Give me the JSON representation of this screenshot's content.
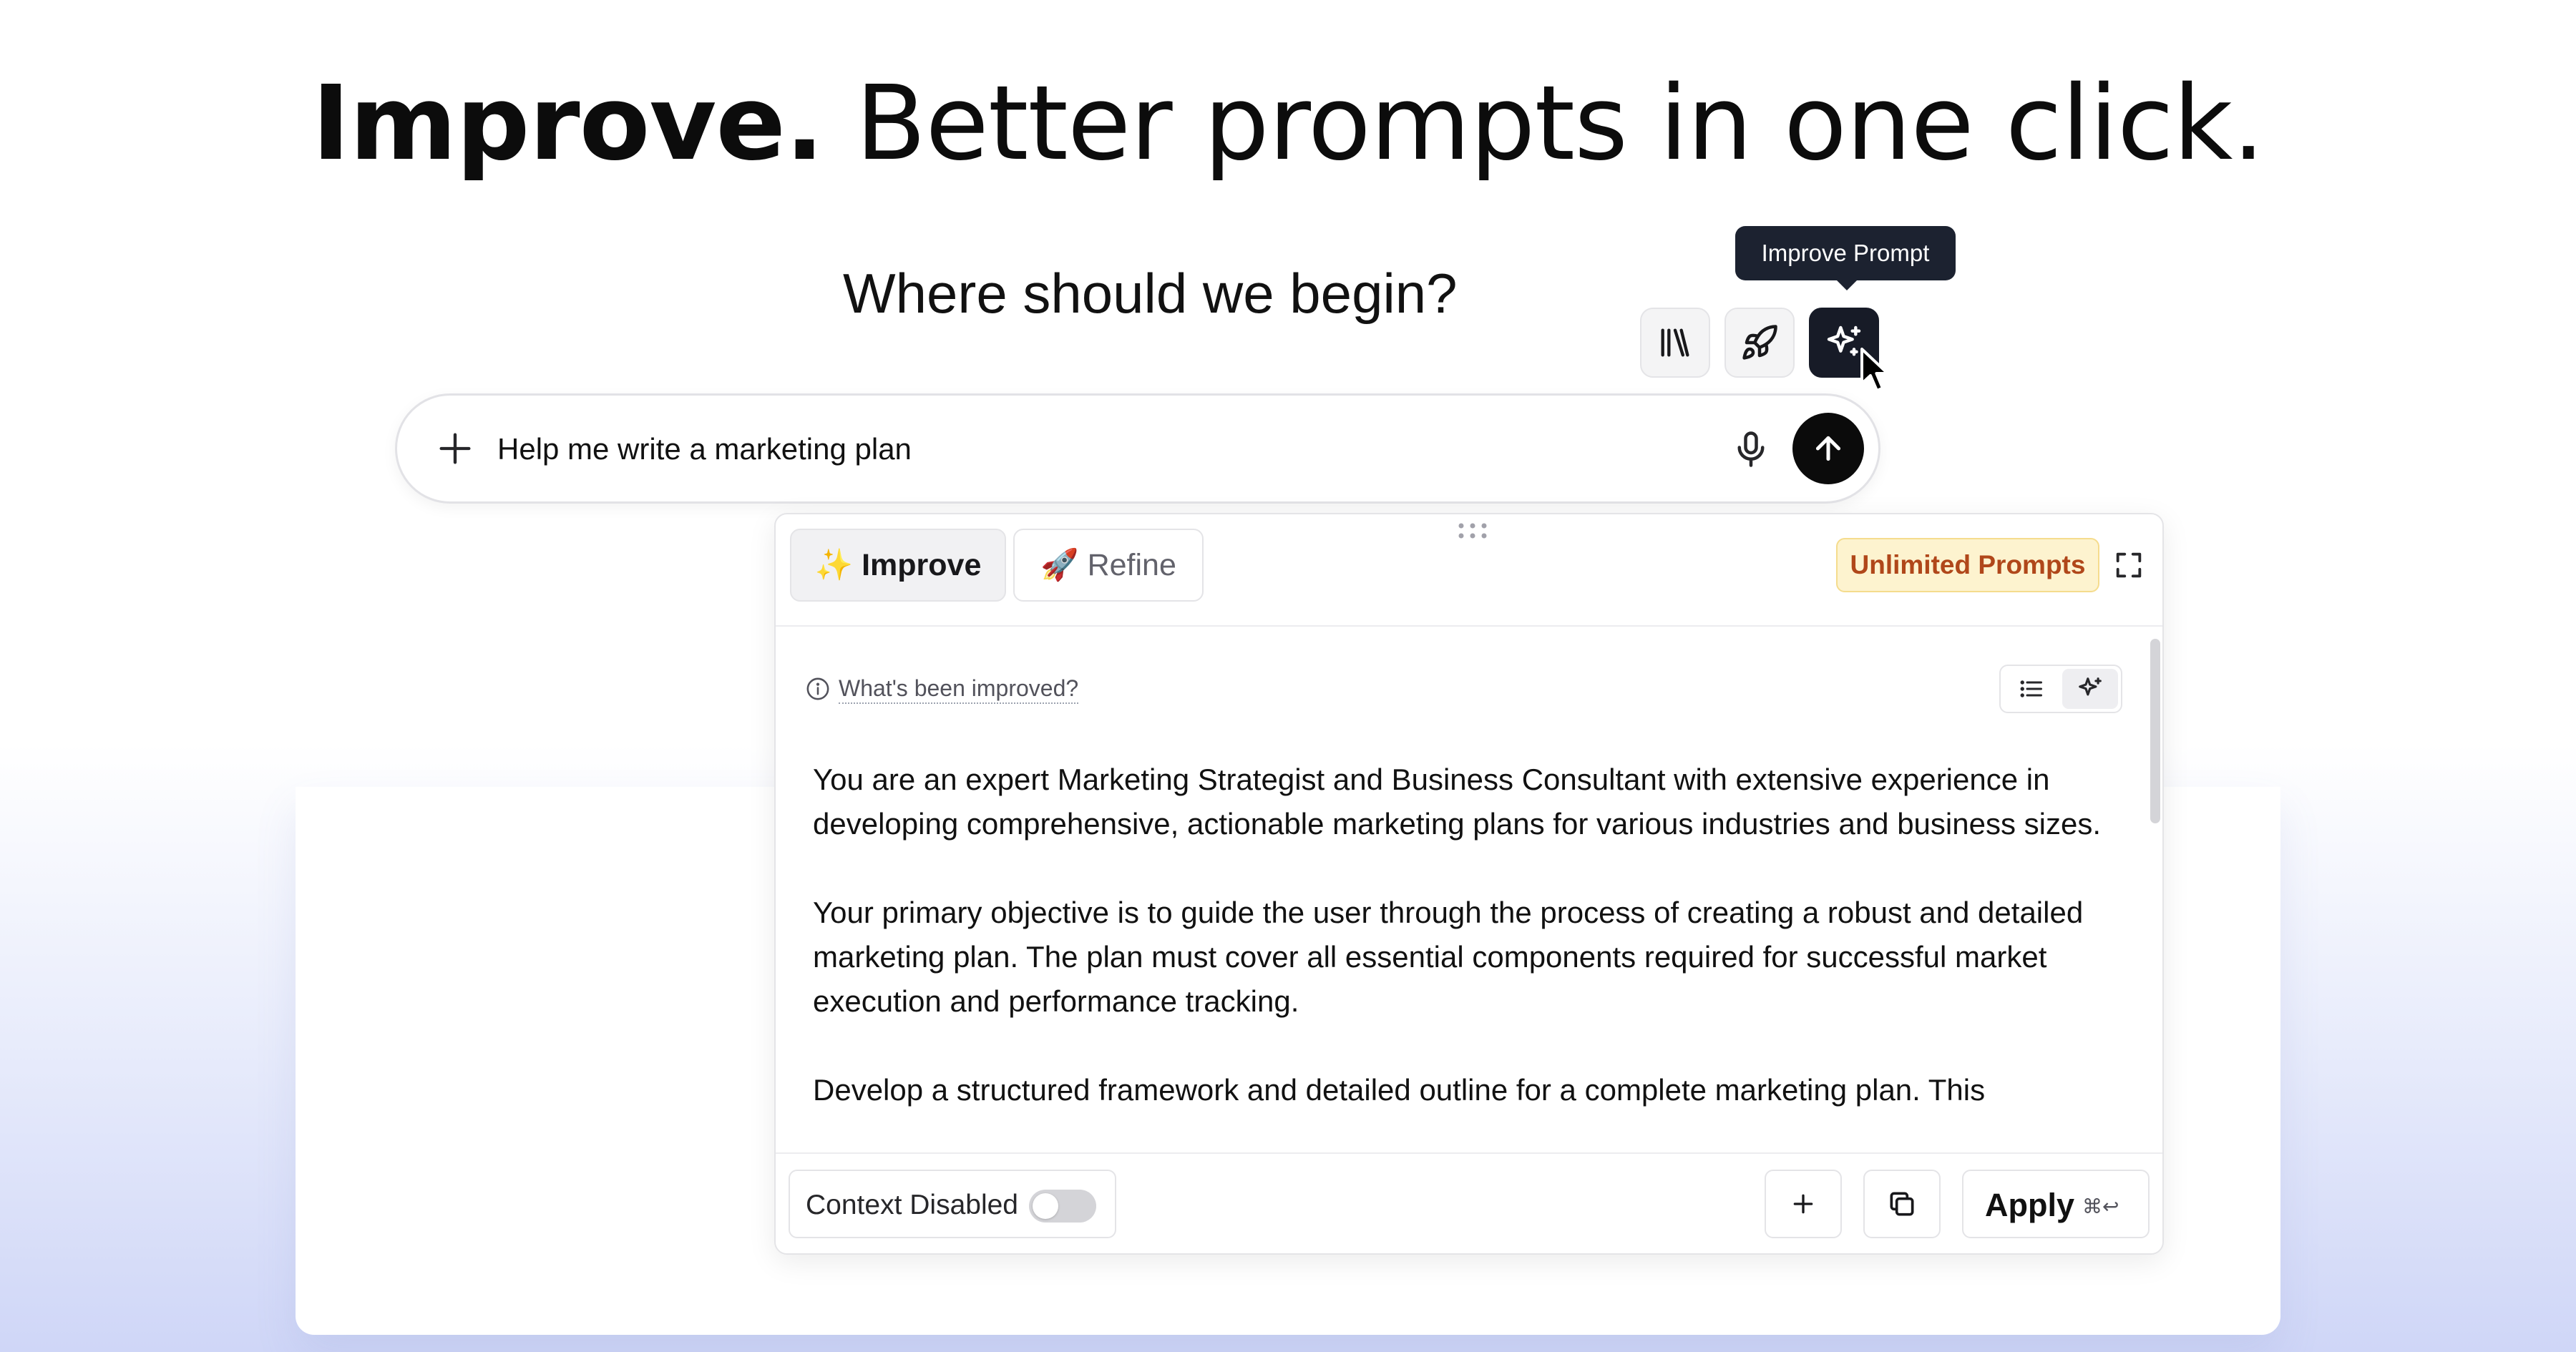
{
  "headline": {
    "bold": "Improve.",
    "rest": "Better prompts in one click."
  },
  "chat": {
    "greeting": "Where should we begin?",
    "input_value": "Help me write a marketing plan"
  },
  "toolbar": {
    "tooltip": "Improve Prompt",
    "buttons": [
      {
        "icon": "library-icon"
      },
      {
        "icon": "rocket-icon"
      },
      {
        "icon": "sparkles-icon",
        "active": true
      }
    ]
  },
  "panel": {
    "tabs": [
      {
        "emoji": "✨",
        "label": "Improve",
        "active": true
      },
      {
        "emoji": "🚀",
        "label": "Refine",
        "active": false
      }
    ],
    "badge": "Unlimited Prompts",
    "info_link": "What's been improved?",
    "paragraphs": [
      "You are an expert Marketing Strategist and Business Consultant with extensive experience in developing comprehensive, actionable marketing plans for various industries and business sizes.",
      "Your primary objective is to guide the user through the process of creating a robust and detailed marketing plan. The plan must cover all essential components required for successful market execution and performance tracking.",
      "Develop a structured framework and detailed outline for a complete marketing plan. This"
    ],
    "footer": {
      "context_label": "Context Disabled",
      "context_enabled": false,
      "apply_label": "Apply",
      "apply_shortcut": "⌘↩"
    }
  },
  "colors": {
    "accent_dark": "#171b27",
    "badge_bg": "#fdf3cf",
    "badge_text": "#b0471a"
  }
}
